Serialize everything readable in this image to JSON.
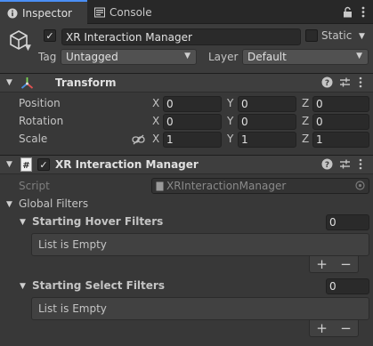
{
  "tabs": [
    {
      "label": "Inspector",
      "icon": "info-icon"
    },
    {
      "label": "Console",
      "icon": "console-icon"
    }
  ],
  "toolbar": {
    "lock_icon": "lock-icon",
    "menu_icon": "kebab-menu-icon"
  },
  "object": {
    "active": true,
    "name": "XR Interaction Manager",
    "static_label": "Static",
    "static": false,
    "tag_label": "Tag",
    "tag_value": "Untagged",
    "layer_label": "Layer",
    "layer_value": "Default"
  },
  "transform": {
    "title": "Transform",
    "rows": [
      {
        "label": "Position",
        "x": "0",
        "y": "0",
        "z": "0"
      },
      {
        "label": "Rotation",
        "x": "0",
        "y": "0",
        "z": "0"
      },
      {
        "label": "Scale",
        "x": "1",
        "y": "1",
        "z": "1"
      }
    ],
    "axis_labels": [
      "X",
      "Y",
      "Z"
    ]
  },
  "component": {
    "title": "XR Interaction Manager",
    "enabled": true,
    "script_label": "Script",
    "script_value": "XRInteractionManager",
    "global_filters_label": "Global Filters",
    "hover_filters_label": "Starting Hover Filters",
    "hover_filters_count": "0",
    "hover_empty_text": "List is Empty",
    "select_filters_label": "Starting Select Filters",
    "select_filters_count": "0",
    "select_empty_text": "List is Empty",
    "add_label": "+",
    "remove_label": "−"
  },
  "colors": {
    "background": "#383838",
    "tab_active_accent": "#4b8ff5",
    "field_bg": "#2a2a2a"
  }
}
